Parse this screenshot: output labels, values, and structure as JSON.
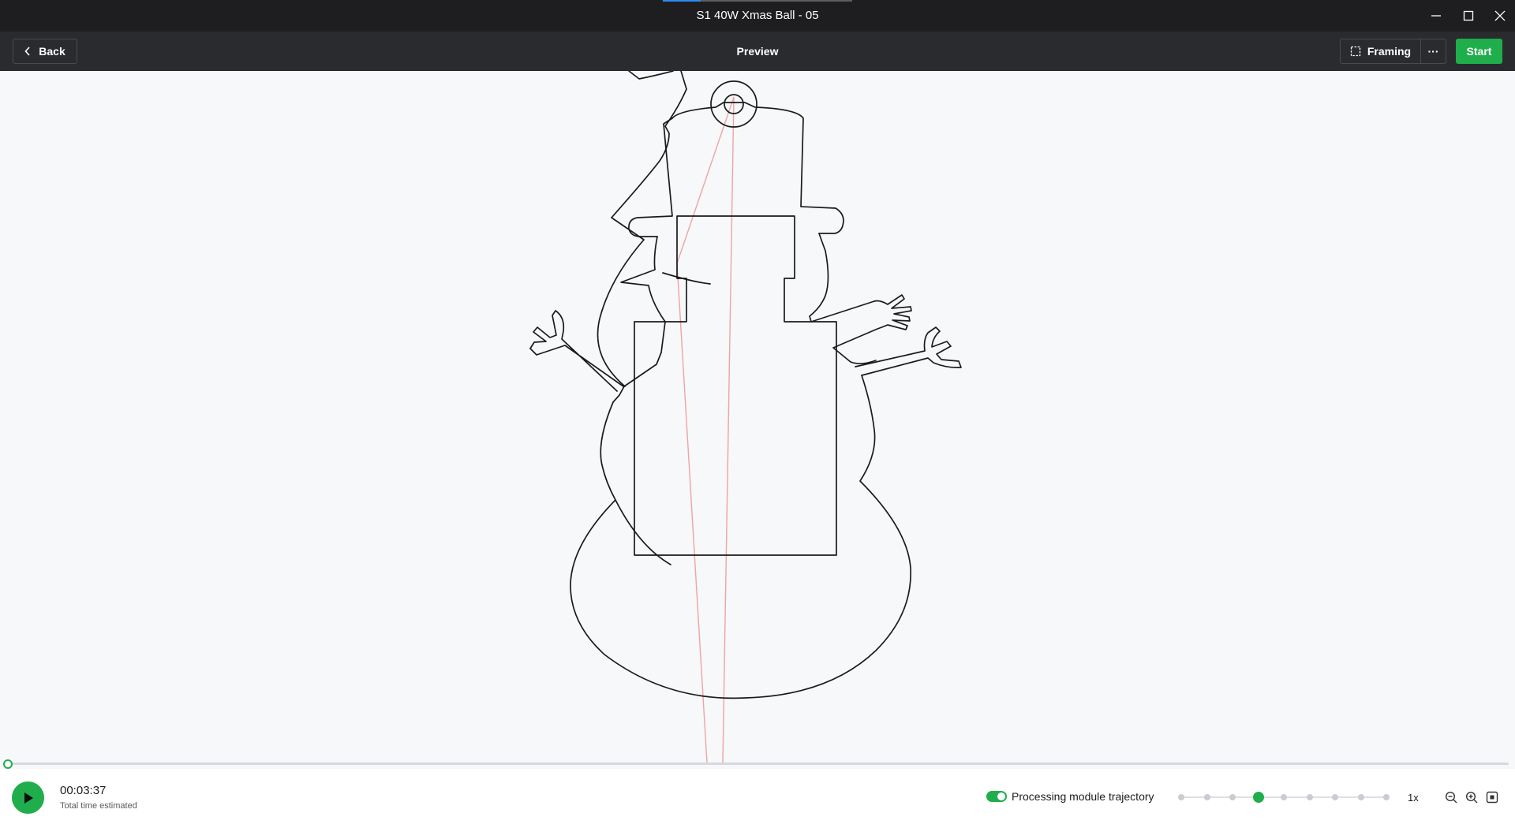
{
  "window": {
    "title": "S1 40W Xmas Ball - 05",
    "controls": [
      "minimize-icon",
      "maximize-icon",
      "close-icon"
    ]
  },
  "toolbar": {
    "back_label": "Back",
    "page_title": "Preview",
    "framing_label": "Framing",
    "more_label": "···",
    "start_label": "Start"
  },
  "colors": {
    "accent": "#1fae4b",
    "title_bar": "#1e1e21",
    "toolbar": "#2a2b2e",
    "canvas": "#f6f8fa",
    "cut_path": "#1a1a1a",
    "travel_path": "#f0a3a3"
  },
  "preview": {
    "design": "snowman ornament outline",
    "progress_fraction": 0,
    "module_trajectory_visible": true
  },
  "footer": {
    "time_value": "00:03:37",
    "time_label": "Total time estimated",
    "trajectory_toggle_label": "Processing module trajectory",
    "trajectory_toggle_on": true,
    "speed_steps": 9,
    "speed_selected_index": 3,
    "speed_label": "1x",
    "zoom_icons": [
      "zoom-out-icon",
      "zoom-in-icon",
      "fit-view-icon"
    ]
  }
}
